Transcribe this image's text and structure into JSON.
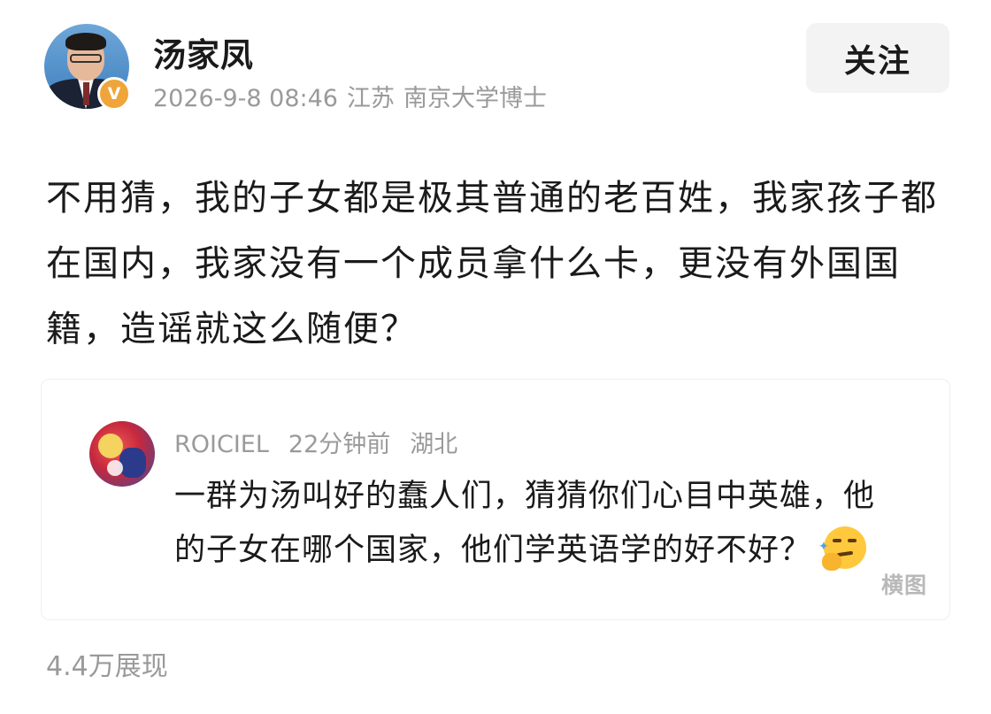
{
  "author": {
    "name": "汤家凤",
    "badge": "V",
    "date": "2026-9-8 08:46",
    "location": "江苏",
    "title": "南京大学博士"
  },
  "follow_label": "关注",
  "post": {
    "text": "不用猜，我的子女都是极其普通的老百姓，我家孩子都在国内，我家没有一个成员拿什么卡，更没有外国国籍，造谣就这么随便？"
  },
  "quote": {
    "user": "ROICIEL",
    "time": "22分钟前",
    "location": "湖北",
    "text": "一群为汤叫好的蠢人们，猜猜你们心目中英雄，他的子女在哪个国家，他们学英语学的好不好？",
    "emoji": "thinking-smirk-emoji",
    "image_label": "横图"
  },
  "views": "4.4万展现"
}
